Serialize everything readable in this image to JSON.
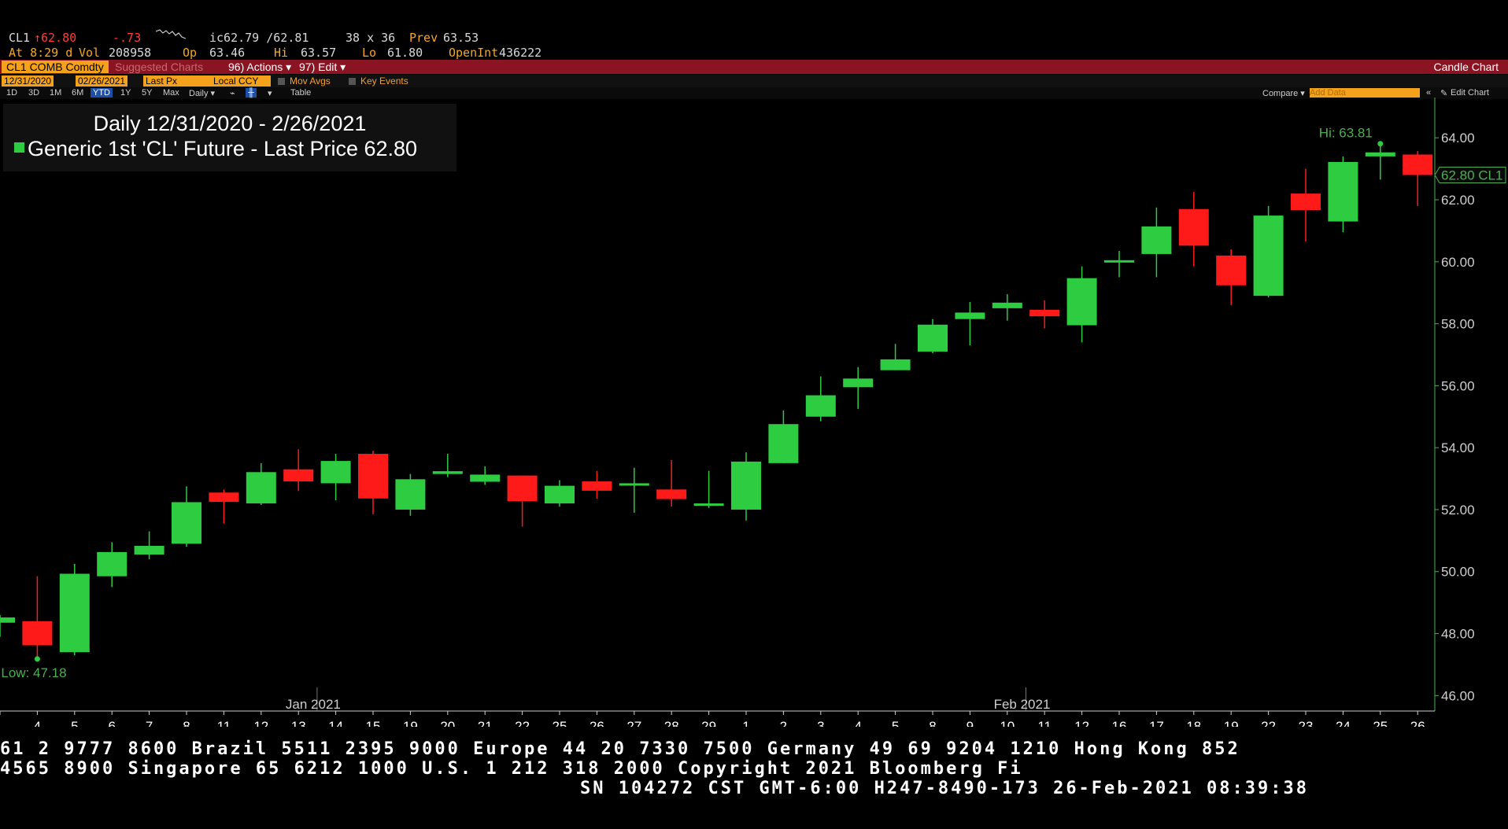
{
  "quote": {
    "ticker": "CL1",
    "arrow": "↑",
    "last": "62.80",
    "change": "-.73",
    "bid_ask": "ic62.79 /62.81",
    "size": "38 x 36",
    "prev_label": "Prev",
    "prev": "63.53",
    "time": "At 8:29 d",
    "vol_label": "Vol",
    "vol": "208958",
    "op_label": "Op",
    "op": "63.46",
    "hi_label": "Hi",
    "hi": "63.57",
    "lo_label": "Lo",
    "lo": "61.80",
    "oi_label": "OpenInt",
    "oi": "436222"
  },
  "toolbar": {
    "security": "CL1 COMB Comdty",
    "suggested": "Suggested Charts",
    "actions": "96) Actions ▾",
    "edit": "97) Edit ▾",
    "chart_type": "Candle Chart",
    "start_date": "12/31/2020",
    "end_date": "02/26/2021",
    "field": "Last Px",
    "currency": "Local CCY",
    "mov_avgs": "Mov Avgs",
    "key_events": "Key Events",
    "periods": [
      "1D",
      "3D",
      "1M",
      "6M",
      "YTD",
      "1Y",
      "5Y",
      "Max"
    ],
    "selected_period": "YTD",
    "frequency": "Daily ▾",
    "table": "Table",
    "compare": "Compare ▾",
    "add_data_placeholder": "Add Data",
    "edit_chart": "Edit Chart"
  },
  "legend": {
    "title": "Daily 12/31/2020 - 2/26/2021",
    "series": "Generic 1st 'CL' Future - Last Price",
    "value": "62.80"
  },
  "chart_data": {
    "type": "candlestick",
    "series_name": "Generic 1st 'CL' Future - Last Price",
    "ylim": [
      45.5,
      65.3
    ],
    "yticks": [
      46,
      48,
      50,
      52,
      54,
      56,
      58,
      60,
      62,
      64
    ],
    "ytick_labels": [
      "46.00",
      "48.00",
      "50.00",
      "52.00",
      "54.00",
      "56.00",
      "58.00",
      "60.00",
      "62.00",
      "64.00"
    ],
    "month_labels": [
      {
        "label": "Jan 2021",
        "index": 9
      },
      {
        "label": "Feb 2021",
        "index": 28
      }
    ],
    "hi_annotation": "Hi: 63.81",
    "low_annotation": "Low: 47.18",
    "last_label": "62.80 CL1",
    "last_value": 62.8,
    "candles": [
      {
        "label": "",
        "open": 48.35,
        "high": 48.6,
        "low": 47.9,
        "close": 48.52
      },
      {
        "label": "4",
        "open": 48.4,
        "high": 49.85,
        "low": 47.18,
        "close": 47.62
      },
      {
        "label": "5",
        "open": 47.4,
        "high": 50.25,
        "low": 47.3,
        "close": 49.93
      },
      {
        "label": "6",
        "open": 49.85,
        "high": 50.95,
        "low": 49.5,
        "close": 50.63
      },
      {
        "label": "7",
        "open": 50.55,
        "high": 51.3,
        "low": 50.4,
        "close": 50.83
      },
      {
        "label": "8",
        "open": 50.9,
        "high": 52.75,
        "low": 50.8,
        "close": 52.24
      },
      {
        "label": "11",
        "open": 52.55,
        "high": 52.65,
        "low": 51.55,
        "close": 52.25
      },
      {
        "label": "12",
        "open": 52.2,
        "high": 53.5,
        "low": 52.15,
        "close": 53.21
      },
      {
        "label": "13",
        "open": 53.3,
        "high": 53.95,
        "low": 52.6,
        "close": 52.91
      },
      {
        "label": "14",
        "open": 52.85,
        "high": 53.8,
        "low": 52.3,
        "close": 53.57
      },
      {
        "label": "15",
        "open": 53.8,
        "high": 53.9,
        "low": 51.85,
        "close": 52.36
      },
      {
        "label": "19",
        "open": 52.0,
        "high": 53.15,
        "low": 51.8,
        "close": 52.98
      },
      {
        "label": "20",
        "open": 53.15,
        "high": 53.8,
        "low": 53.05,
        "close": 53.24
      },
      {
        "label": "21",
        "open": 52.9,
        "high": 53.4,
        "low": 52.8,
        "close": 53.13
      },
      {
        "label": "22",
        "open": 53.1,
        "high": 53.1,
        "low": 51.45,
        "close": 52.27
      },
      {
        "label": "25",
        "open": 52.2,
        "high": 52.95,
        "low": 52.1,
        "close": 52.77
      },
      {
        "label": "26",
        "open": 52.91,
        "high": 53.25,
        "low": 52.35,
        "close": 52.61
      },
      {
        "label": "27",
        "open": 52.78,
        "high": 53.35,
        "low": 51.9,
        "close": 52.85
      },
      {
        "label": "28",
        "open": 52.65,
        "high": 53.6,
        "low": 52.1,
        "close": 52.34
      },
      {
        "label": "29",
        "open": 52.2,
        "high": 53.25,
        "low": 52.05,
        "close": 52.2
      },
      {
        "label": "1",
        "open": 52.0,
        "high": 53.85,
        "low": 51.65,
        "close": 53.55
      },
      {
        "label": "2",
        "open": 53.5,
        "high": 55.2,
        "low": 53.5,
        "close": 54.76
      },
      {
        "label": "3",
        "open": 55.0,
        "high": 56.3,
        "low": 54.85,
        "close": 55.69
      },
      {
        "label": "4",
        "open": 55.95,
        "high": 56.6,
        "low": 55.25,
        "close": 56.23
      },
      {
        "label": "5",
        "open": 56.5,
        "high": 57.35,
        "low": 56.5,
        "close": 56.85
      },
      {
        "label": "8",
        "open": 57.1,
        "high": 58.15,
        "low": 57.05,
        "close": 57.97
      },
      {
        "label": "9",
        "open": 58.15,
        "high": 58.7,
        "low": 57.3,
        "close": 58.36
      },
      {
        "label": "10",
        "open": 58.5,
        "high": 58.95,
        "low": 58.1,
        "close": 58.68
      },
      {
        "label": "11",
        "open": 58.45,
        "high": 58.75,
        "low": 57.85,
        "close": 58.24
      },
      {
        "label": "12",
        "open": 57.95,
        "high": 59.85,
        "low": 57.4,
        "close": 59.47
      },
      {
        "label": "16",
        "open": 60.0,
        "high": 60.35,
        "low": 59.5,
        "close": 60.05
      },
      {
        "label": "17",
        "open": 60.25,
        "high": 61.75,
        "low": 59.5,
        "close": 61.14
      },
      {
        "label": "18",
        "open": 61.7,
        "high": 62.25,
        "low": 59.85,
        "close": 60.52
      },
      {
        "label": "19",
        "open": 60.2,
        "high": 60.4,
        "low": 58.6,
        "close": 59.24
      },
      {
        "label": "22",
        "open": 58.9,
        "high": 61.8,
        "low": 58.85,
        "close": 61.49
      },
      {
        "label": "23",
        "open": 62.2,
        "high": 63.0,
        "low": 60.65,
        "close": 61.67
      },
      {
        "label": "24",
        "open": 61.3,
        "high": 63.4,
        "low": 60.95,
        "close": 63.22
      },
      {
        "label": "25",
        "open": 63.4,
        "high": 63.81,
        "low": 62.65,
        "close": 63.53
      },
      {
        "label": "26",
        "open": 63.46,
        "high": 63.57,
        "low": 61.8,
        "close": 62.8
      }
    ]
  },
  "ticker": {
    "line1": "61 2 9777 8600 Brazil 5511 2395 9000 Europe 44 20 7330 7500 Germany 49 69 9204 1210 Hong Kong 852",
    "line2": " 4565 8900      Singapore 65 6212 1000      U.S. 1 212 318 2000          Copyright 2021 Bloomberg Fi",
    "line3": "SN 104272 CST  GMT-6:00 H247-8490-173 26-Feb-2021 08:39:38"
  },
  "colors": {
    "up": "#2ecc40",
    "down": "#ff1a1a",
    "axis": "#4caf50",
    "toolbar_red": "#8b1423",
    "accent_orange": "#f4a11c"
  }
}
